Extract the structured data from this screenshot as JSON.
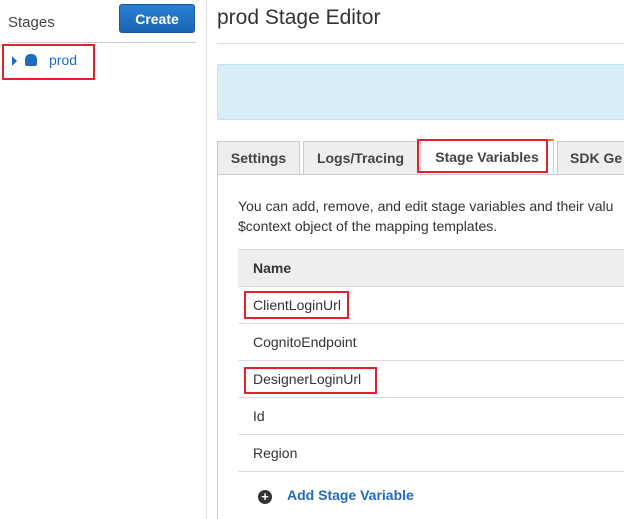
{
  "sidebar": {
    "title": "Stages",
    "create_label": "Create",
    "stages": [
      {
        "label": "prod"
      }
    ]
  },
  "header": {
    "title": "prod Stage Editor"
  },
  "tabs": [
    {
      "label": "Settings"
    },
    {
      "label": "Logs/Tracing"
    },
    {
      "label": "Stage Variables"
    },
    {
      "label": "SDK Ge"
    }
  ],
  "content": {
    "description_line1": "You can add, remove, and edit stage variables and their valu",
    "description_line2": "$context object of the mapping templates.",
    "column_name": "Name",
    "rows": [
      "ClientLoginUrl",
      "CognitoEndpoint",
      "DesignerLoginUrl",
      "Id",
      "Region"
    ],
    "add_label": "Add Stage Variable"
  }
}
